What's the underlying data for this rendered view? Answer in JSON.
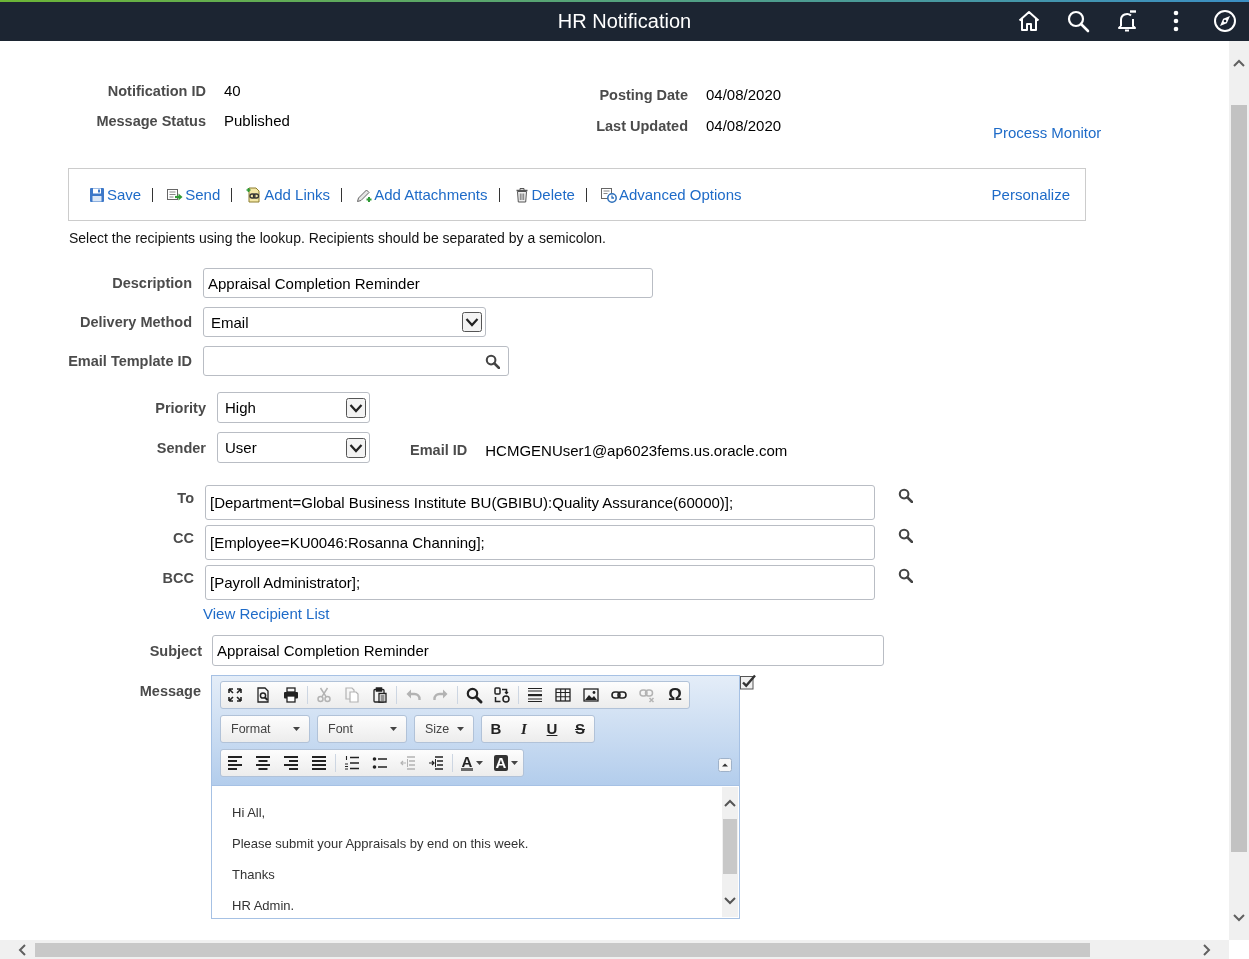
{
  "header": {
    "title": "HR Notification"
  },
  "summary": {
    "left": [
      {
        "label": "Notification ID",
        "value": "40"
      },
      {
        "label": "Message Status",
        "value": "Published"
      }
    ],
    "right": [
      {
        "label": "Posting Date",
        "value": "04/08/2020"
      },
      {
        "label": "Last Updated",
        "value": "04/08/2020"
      }
    ],
    "link": "Process Monitor"
  },
  "toolbar": {
    "actions": [
      {
        "kind": "save",
        "label": "Save"
      },
      {
        "kind": "send",
        "label": "Send"
      },
      {
        "kind": "links",
        "label": "Add Links"
      },
      {
        "kind": "attachments",
        "label": "Add Attachments"
      },
      {
        "kind": "delete",
        "label": "Delete"
      },
      {
        "kind": "options",
        "label": "Advanced Options"
      }
    ],
    "personalize": "Personalize"
  },
  "instructions": "Select the recipients using the lookup. Recipients should be separated by a semicolon.",
  "details": [
    {
      "kind": "text",
      "label": "Description",
      "value": "Appraisal Completion Reminder"
    },
    {
      "kind": "select",
      "label": "Delivery Method",
      "value": "Email"
    },
    {
      "kind": "lookup",
      "label": "Email Template ID"
    }
  ],
  "settings": [
    {
      "kind": "select",
      "label": "Priority",
      "value": "High"
    },
    {
      "kind": "select",
      "label": "Sender",
      "value": "User"
    }
  ],
  "email_id": {
    "label": "Email ID",
    "value": "HCMGENUser1@ap6023fems.us.oracle.com"
  },
  "recipients": [
    {
      "label": "To",
      "value": "[Department=Global Business Institute BU(GBIBU):Quality Assurance(60000)];"
    },
    {
      "label": "CC",
      "value": "[Employee=KU0046:Rosanna Channing];"
    },
    {
      "label": "BCC",
      "value": "[Payroll Administrator];"
    }
  ],
  "recipient_list_link": "View Recipient List",
  "subject": {
    "label": "Subject",
    "value": "Appraisal Completion Reminder"
  },
  "message": {
    "label": "Message",
    "toolbar_rows": [
      [
        {
          "kind": "buttons",
          "groups": [
            [
              {
                "kind": "maximize",
                "disabled": false
              },
              {
                "kind": "preview",
                "disabled": false
              },
              {
                "kind": "print",
                "disabled": false
              }
            ],
            [
              {
                "kind": "cut",
                "disabled": true
              },
              {
                "kind": "copy",
                "disabled": true
              },
              {
                "kind": "paste",
                "disabled": false
              }
            ],
            [
              {
                "kind": "undo",
                "disabled": true
              },
              {
                "kind": "redo",
                "disabled": true
              }
            ],
            [
              {
                "kind": "find",
                "disabled": false
              },
              {
                "kind": "replace",
                "disabled": false
              }
            ],
            [
              {
                "kind": "rule",
                "disabled": false
              },
              {
                "kind": "table",
                "disabled": false
              },
              {
                "kind": "image",
                "disabled": false
              },
              {
                "kind": "link",
                "disabled": false
              },
              {
                "kind": "unlink",
                "disabled": true
              },
              {
                "kind": "symbol",
                "text": "Ω",
                "disabled": false
              }
            ]
          ]
        }
      ],
      [
        {
          "kind": "combo",
          "text": "Format"
        },
        {
          "kind": "combo",
          "text": "Font"
        },
        {
          "kind": "combo",
          "text": "Size"
        },
        {
          "kind": "buttons",
          "groups": [
            [
              {
                "kind": "bold",
                "text": "B",
                "disabled": false
              },
              {
                "kind": "italic",
                "text": "I",
                "disabled": false
              },
              {
                "kind": "underline",
                "text": "U",
                "disabled": false
              },
              {
                "kind": "strike",
                "text": "S",
                "disabled": false
              }
            ]
          ]
        }
      ],
      [
        {
          "kind": "buttons",
          "groups": [
            [
              {
                "kind": "align_left",
                "disabled": false
              },
              {
                "kind": "align_center",
                "disabled": false
              },
              {
                "kind": "align_right",
                "disabled": false
              },
              {
                "kind": "justify",
                "disabled": false
              }
            ],
            [
              {
                "kind": "numbered",
                "disabled": false
              },
              {
                "kind": "bulleted",
                "disabled": false
              },
              {
                "kind": "outdent",
                "disabled": true
              },
              {
                "kind": "indent",
                "disabled": false
              }
            ],
            [
              {
                "kind": "text_color",
                "text": "A",
                "disabled": false
              },
              {
                "kind": "bg_color",
                "text": "A",
                "disabled": false
              }
            ]
          ]
        }
      ]
    ],
    "body": [
      "Hi All,",
      "Please submit your Appraisals by end on this week.",
      "Thanks",
      "HR Admin."
    ]
  }
}
